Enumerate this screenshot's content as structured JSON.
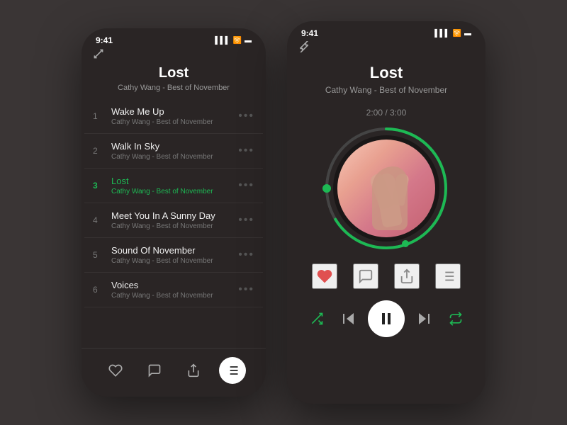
{
  "list_phone": {
    "status_time": "9:41",
    "track_title": "Lost",
    "track_subtitle": "Cathy Wang - Best of November",
    "tracks": [
      {
        "num": "1",
        "name": "Wake Me Up",
        "artist": "Cathy Wang - Best of November",
        "active": false
      },
      {
        "num": "2",
        "name": "Walk In Sky",
        "artist": "Cathy Wang - Best of November",
        "active": false
      },
      {
        "num": "3",
        "name": "Lost",
        "artist": "Cathy Wang - Best of November",
        "active": true
      },
      {
        "num": "4",
        "name": "Meet You In A Sunny Day",
        "artist": "Cathy Wang - Best of November",
        "active": false
      },
      {
        "num": "5",
        "name": "Sound Of November",
        "artist": "Cathy Wang - Best of November",
        "active": false
      },
      {
        "num": "6",
        "name": "Voices",
        "artist": "Cathy Wang - Best of November",
        "active": false
      }
    ],
    "more_btn": "···"
  },
  "player_phone": {
    "status_time": "9:41",
    "track_title": "Lost",
    "track_subtitle": "Cathy Wang - Best of November",
    "time_current": "2:00",
    "time_total": "3:00",
    "time_display": "2:00 / 3:00",
    "progress_percent": 66
  },
  "colors": {
    "green": "#1db954",
    "heart": "#e05050",
    "bg": "#2a2525",
    "text_primary": "#ffffff",
    "text_secondary": "#999999"
  }
}
